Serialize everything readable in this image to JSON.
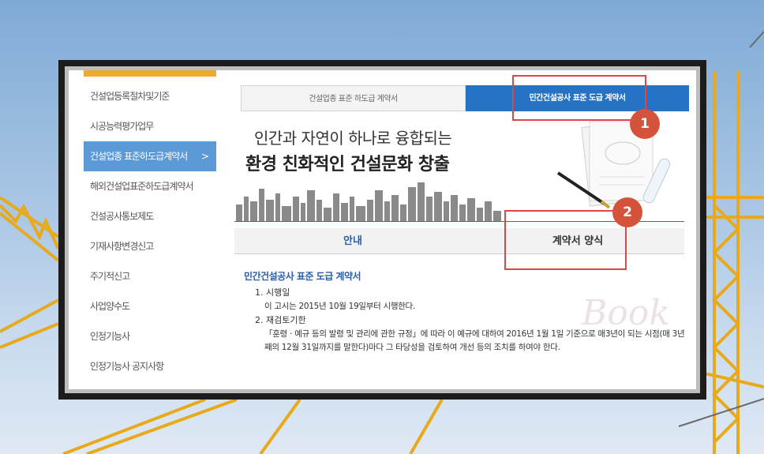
{
  "sidebar": {
    "items": [
      {
        "label": "건설업등록절차및기준"
      },
      {
        "label": "시공능력평가업무"
      },
      {
        "label": "건설업종 표준하도급계약서",
        "active": true,
        "chevron": "chevron-right-icon"
      },
      {
        "label": "해외건설업표준하도급계약서"
      },
      {
        "label": "건설공사통보제도"
      },
      {
        "label": "기재사항변경신고"
      },
      {
        "label": "주기적신고"
      },
      {
        "label": "사업양수도"
      },
      {
        "label": "인정기능사"
      },
      {
        "label": "인정기능사 공지사항"
      }
    ],
    "chevron_glyph": ">"
  },
  "tabs": [
    {
      "label": "건설업종 표준 하도급 계약서"
    },
    {
      "label": "민간건설공사 표준 도급 계약서",
      "active": true
    }
  ],
  "banner": {
    "line1": "인간과 자연이 하나로 융합되는",
    "line2": "환경 친화적인 건설문화 창출"
  },
  "subtabs": [
    {
      "label": "안내"
    },
    {
      "label": "계약서 양식"
    }
  ],
  "document": {
    "title": "민간건설공사 표준 도급 계약서",
    "sections": [
      {
        "heading": "1. 시행일",
        "body": "이 고시는 2015년 10월 19일부터 시행한다."
      },
      {
        "heading": "2. 재검토기한",
        "body": "「훈령ㆍ예규 등의 발령 및 관리에 관한 규정」에 따라 이 예규에 대하여 2016년 1월 1일 기준으로 매3년이 되는 시점(매 3년째의 12월 31일까지를 말한다)마다 그 타당성을 검토하여 개선 등의 조치를 하여야 한다."
      }
    ]
  },
  "annotations": [
    {
      "label": "1"
    },
    {
      "label": "2"
    }
  ],
  "watermark": "Book",
  "colors": {
    "accent_blue": "#2672c4",
    "sidebar_active": "#5b9ad6",
    "sidebar_top_bar": "#efa92f",
    "annotation_red": "#e04545",
    "badge": "#d4533a"
  }
}
